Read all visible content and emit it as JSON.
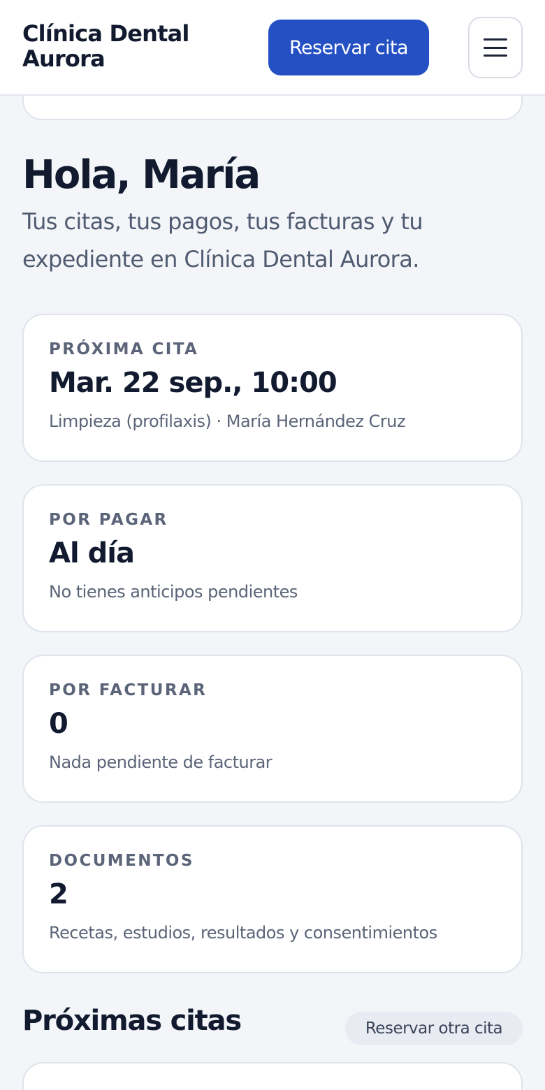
{
  "header": {
    "brand": "Clínica Dental Aurora",
    "book_button": "Reservar cita",
    "menu_icon": "hamburger-menu-icon"
  },
  "greeting": {
    "title": "Hola, María",
    "subtitle": "Tus citas, tus pagos, tus facturas y tu expediente en Clínica Dental Aurora."
  },
  "cards": [
    {
      "label": "PRÓXIMA CITA",
      "value": "Mar. 22 sep., 10:00",
      "description": "Limpieza (profilaxis) · María Hernández Cruz"
    },
    {
      "label": "POR PAGAR",
      "value": "Al día",
      "description": "No tienes anticipos pendientes"
    },
    {
      "label": "POR FACTURAR",
      "value": "0",
      "description": "Nada pendiente de facturar"
    },
    {
      "label": "DOCUMENTOS",
      "value": "2",
      "description": "Recetas, estudios, resultados y consentimientos"
    }
  ],
  "upcoming": {
    "title": "Próximas citas",
    "book_another_button": "Reservar otra cita"
  },
  "colors": {
    "primary": "#2450c4",
    "background": "#f3f5f9",
    "text": "#111a2e",
    "muted": "#5b6478"
  }
}
